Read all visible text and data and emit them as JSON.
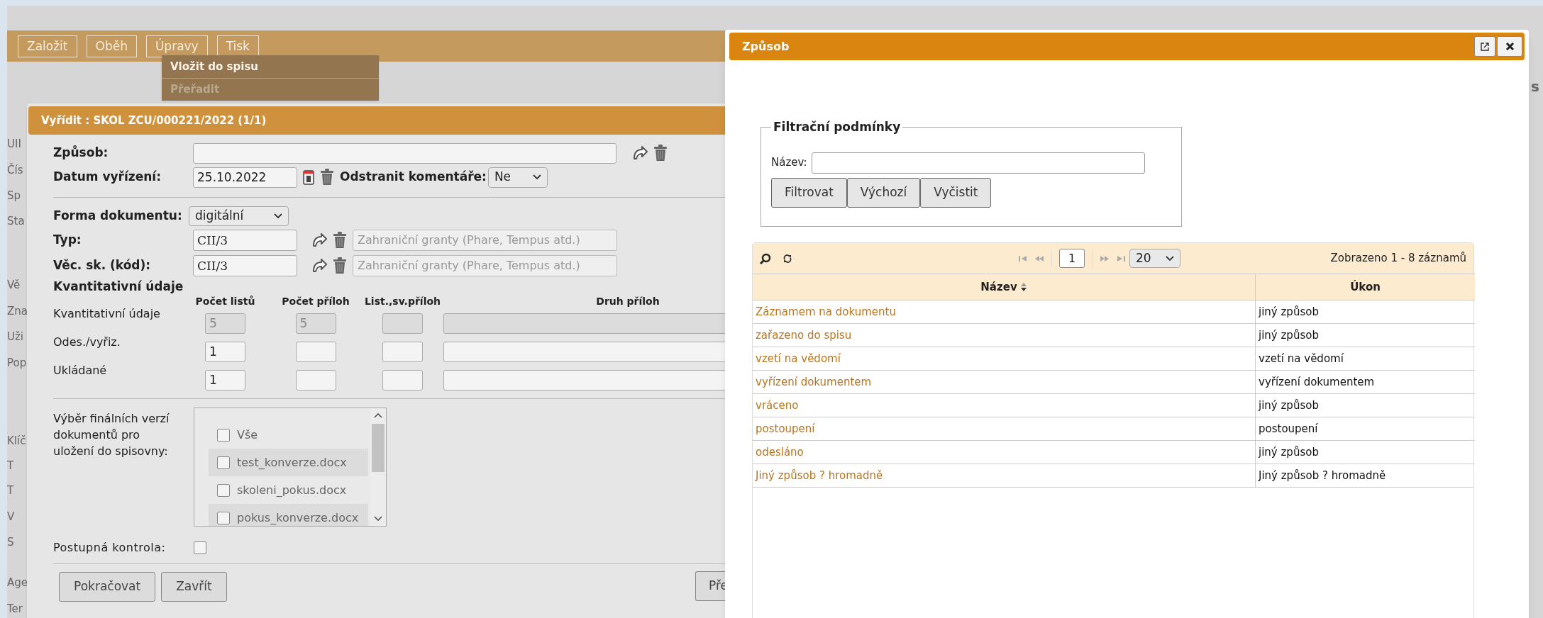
{
  "background": {
    "fragments_left": [
      "UII",
      "Čís",
      "Sp",
      "Sta",
      "Vě",
      "Zna",
      "Uži",
      "Pop",
      "Klíč",
      "T",
      "T",
      "V",
      "S",
      "Age",
      "Ter"
    ],
    "fragment_right": "s"
  },
  "toolbar": {
    "buttons": [
      "Založit",
      "Oběh",
      "Úpravy",
      "Tisk"
    ],
    "menu": [
      {
        "label": "Vložit do spisu",
        "disabled": false
      },
      {
        "label": "Přeřadit",
        "disabled": true
      }
    ]
  },
  "left_dialog": {
    "title": "Vyřídit : SKOL ZCU/000221/2022 (1/1)",
    "zpusob": {
      "label": "Způsob:"
    },
    "datum": {
      "label": "Datum vyřízení:",
      "value": "25.10.2022",
      "comment_label": "Odstranit komentáře:",
      "comment_value": "Ne"
    },
    "forma": {
      "label": "Forma dokumentu:",
      "value": "digitální"
    },
    "classifications": [
      {
        "label": "Typ:",
        "code": "CII/3",
        "description": "Zahraniční granty (Phare, Tempus atd.)"
      },
      {
        "label": "Věc. sk. (kód):",
        "code": "CII/3",
        "description": "Zahraniční granty (Phare, Tempus atd.)"
      }
    ],
    "quantity": {
      "heading": "Kvantitativní údaje",
      "columns": [
        "Počet listů",
        "Počet příloh",
        "List.,sv.příloh",
        "Druh příloh"
      ],
      "rows": [
        {
          "label": "Kvantitativní údaje",
          "disabled": true,
          "values": [
            "5",
            "5"
          ]
        },
        {
          "label": "Odes./vyřiz.",
          "disabled": false,
          "values": [
            "1"
          ]
        },
        {
          "label": "Ukládané",
          "disabled": false,
          "values": [
            "1"
          ]
        }
      ]
    },
    "versions": {
      "label": "Výběr finálních verzí dokumentů pro uložení do spisovny:",
      "items": [
        {
          "label": "Vše",
          "checked": false
        },
        {
          "label": "test_konverze.docx",
          "checked": false
        },
        {
          "label": "skoleni_pokus.docx",
          "checked": false
        },
        {
          "label": "pokus_konverze.docx",
          "checked": false
        }
      ]
    },
    "postupna": {
      "label": "Postupná kontrola:",
      "checked": false
    },
    "buttons": [
      "Pokračovat",
      "Zavřít"
    ],
    "cut_button": "Pře"
  },
  "right_dialog": {
    "title": "Způsob",
    "filter": {
      "legend": "Filtrační podmínky",
      "label": "Název:",
      "buttons": [
        "Filtrovat",
        "Výchozí",
        "Vyčistit"
      ]
    },
    "grid": {
      "page": "1",
      "page_size": "20",
      "summary": "Zobrazeno 1 - 8 záznamů",
      "columns": [
        "Název",
        "Úkon"
      ],
      "rows": [
        [
          "Záznamem na dokumentu",
          "jiný způsob"
        ],
        [
          "zařazeno do spisu",
          "jiný způsob"
        ],
        [
          "vzetí na vědomí",
          "vzetí na vědomí"
        ],
        [
          "vyřízení dokumentem",
          "vyřízení dokumentem"
        ],
        [
          "vráceno",
          "jiný způsob"
        ],
        [
          "postoupení",
          "postoupení"
        ],
        [
          "odesláno",
          "jiný způsob"
        ],
        [
          "Jiný způsob ? hromadně",
          "Jiný způsob ? hromadně"
        ]
      ]
    }
  }
}
